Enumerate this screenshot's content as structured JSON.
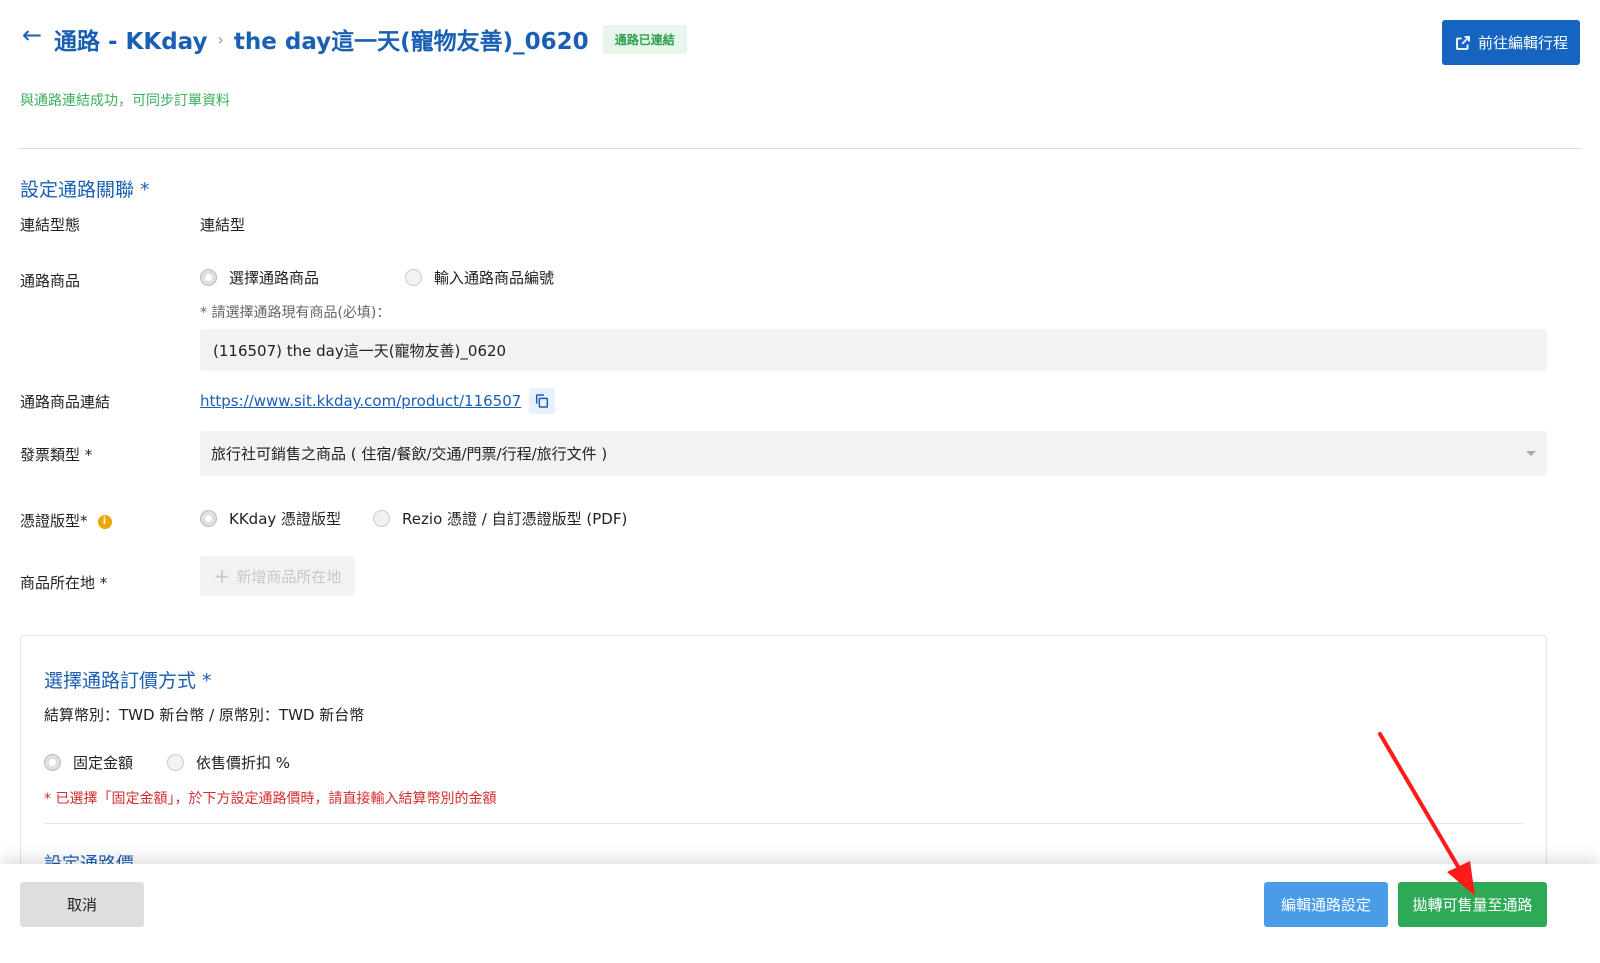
{
  "header": {
    "channel": "通路 - KKday",
    "product": "the day這一天(寵物友善)_0620",
    "status_badge": "通路已連結",
    "edit_trip_label": "前往編輯行程"
  },
  "success_message": "與通路連結成功，可同步訂單資料",
  "association": {
    "section_title": "設定通路關聯 *",
    "link_type_label": "連結型態",
    "link_type_value": "連結型",
    "channel_product_label": "通路商品",
    "option_select": "選擇通路商品",
    "option_input": "輸入通路商品編號",
    "hint": "* 請選擇通路現有商品(必填)：",
    "selected_product": "(116507) the day這一天(寵物友善)_0620",
    "product_link_label": "通路商品連結",
    "product_link": "https://www.sit.kkday.com/product/116507",
    "invoice_label": "發票類型 *",
    "invoice_value": "旅行社可銷售之商品 ( 住宿/餐飲/交通/門票/行程/旅行文件 )",
    "voucher_label": "憑證版型*",
    "voucher_option_kkday": "KKday 憑證版型",
    "voucher_option_rezio": "Rezio 憑證 / 自訂憑證版型 (PDF)",
    "location_label": "商品所在地 *",
    "add_location": "新增商品所在地"
  },
  "pricing": {
    "title": "選擇通路訂價方式 *",
    "currency": "結算幣別：TWD 新台幣 / 原幣別：TWD 新台幣",
    "option_fixed": "固定金額",
    "option_discount": "依售價折扣 %",
    "warning": "* 已選擇「固定金額」，於下方設定通路價時，請直接輸入結算幣別的金額",
    "sub_title": "設定通路價"
  },
  "footer": {
    "cancel": "取消",
    "edit_channel": "編輯通路設定",
    "push": "拋轉可售量至通路"
  },
  "colors": {
    "primary": "#1a5fb4",
    "success": "#2eaa57",
    "warning": "#d32f2f",
    "annotation": "#ff1a1a"
  }
}
